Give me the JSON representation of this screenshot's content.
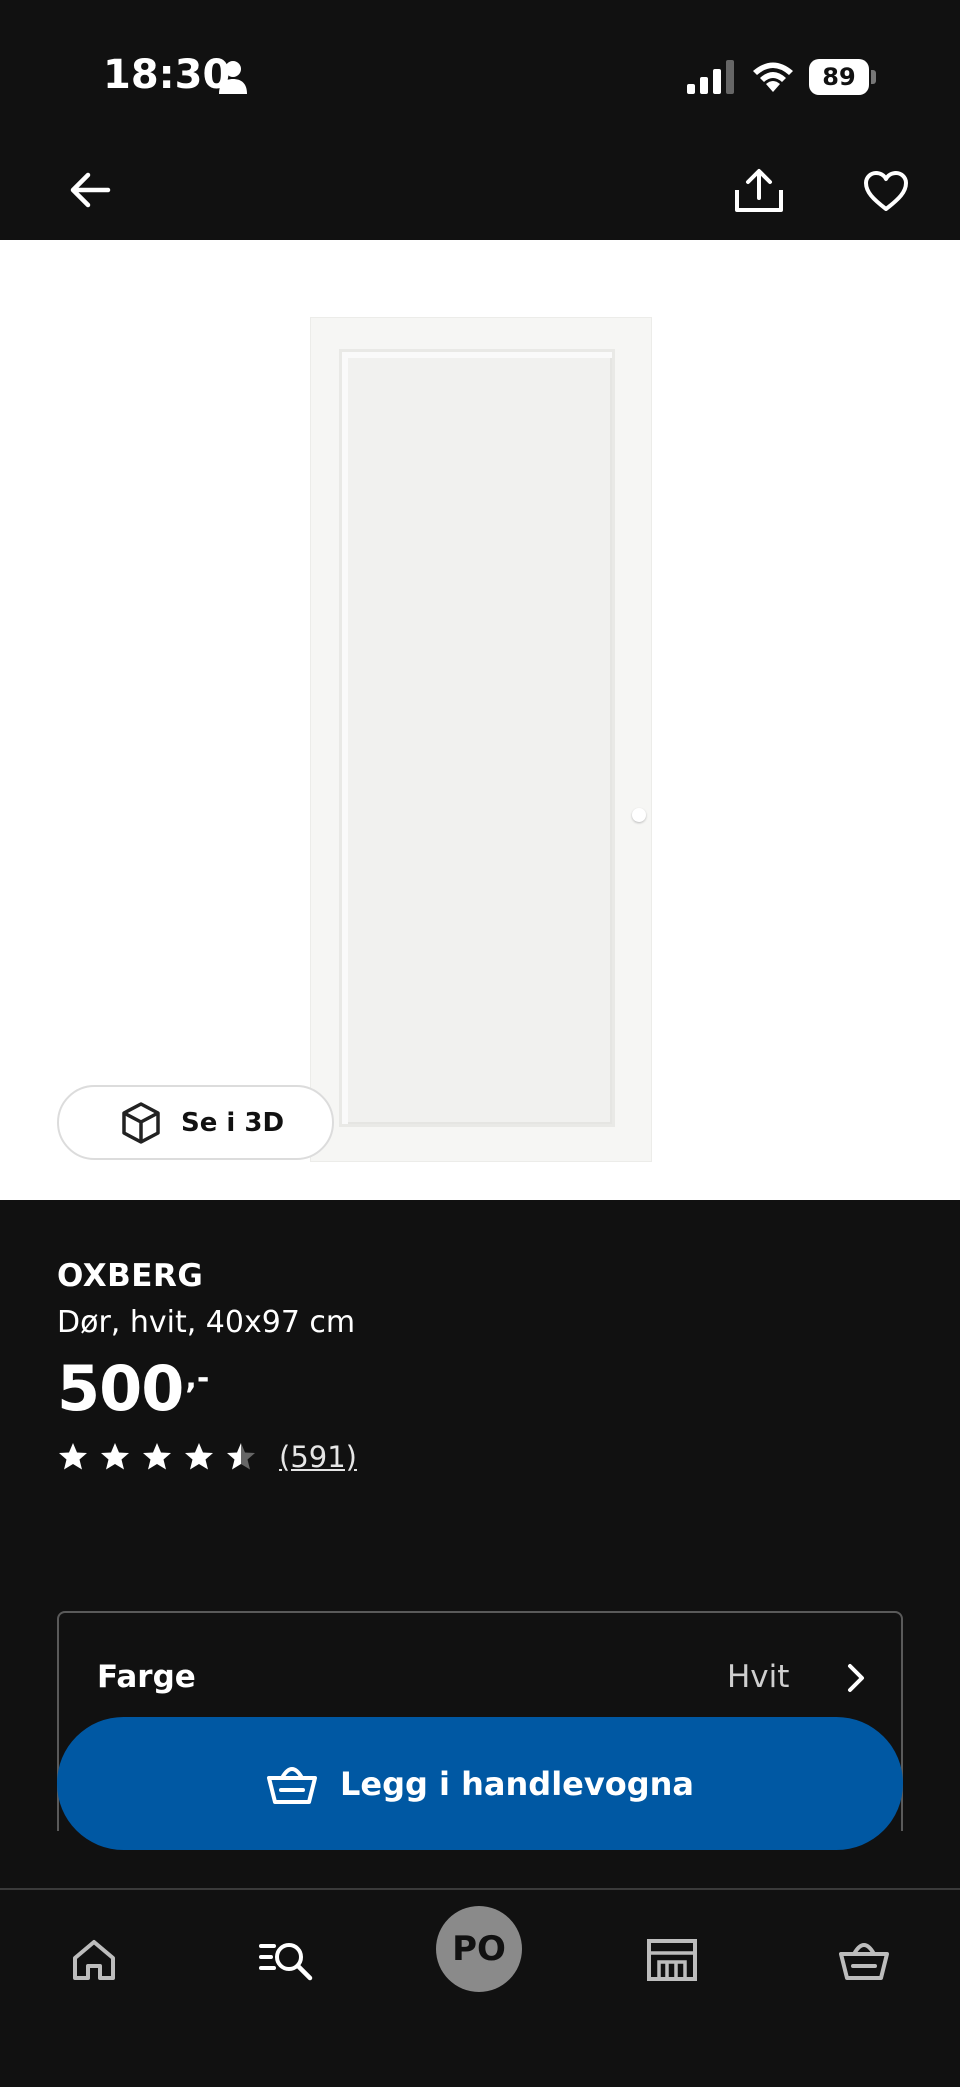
{
  "status_bar": {
    "time": "18:30",
    "battery_level": "89",
    "icons": [
      "person-icon",
      "signal-icon",
      "wifi-icon",
      "battery-icon"
    ]
  },
  "topbar": {
    "icons": [
      "back-arrow-icon",
      "share-icon",
      "heart-icon"
    ]
  },
  "product_image": {
    "see_3d_label": "Se i 3D",
    "see_3d_icon": "cube-icon"
  },
  "product": {
    "name": "OXBERG",
    "description": "Dør, hvit, 40x97 cm",
    "price": "500",
    "price_suffix": ",-",
    "rating": 4.5,
    "rating_max": 5,
    "review_count": "(591)"
  },
  "options": {
    "label": "Farge",
    "value": "Hvit"
  },
  "cta": {
    "label": "Legg i handlevogna",
    "icon": "cart-icon"
  },
  "bottom_nav": {
    "items": [
      "home-icon",
      "search-icon",
      "avatar",
      "store-icon",
      "cart-icon"
    ],
    "avatar_initials": "PO"
  },
  "colors": {
    "background": "#111111",
    "accent": "#0058a3",
    "text": "#ffffff"
  }
}
